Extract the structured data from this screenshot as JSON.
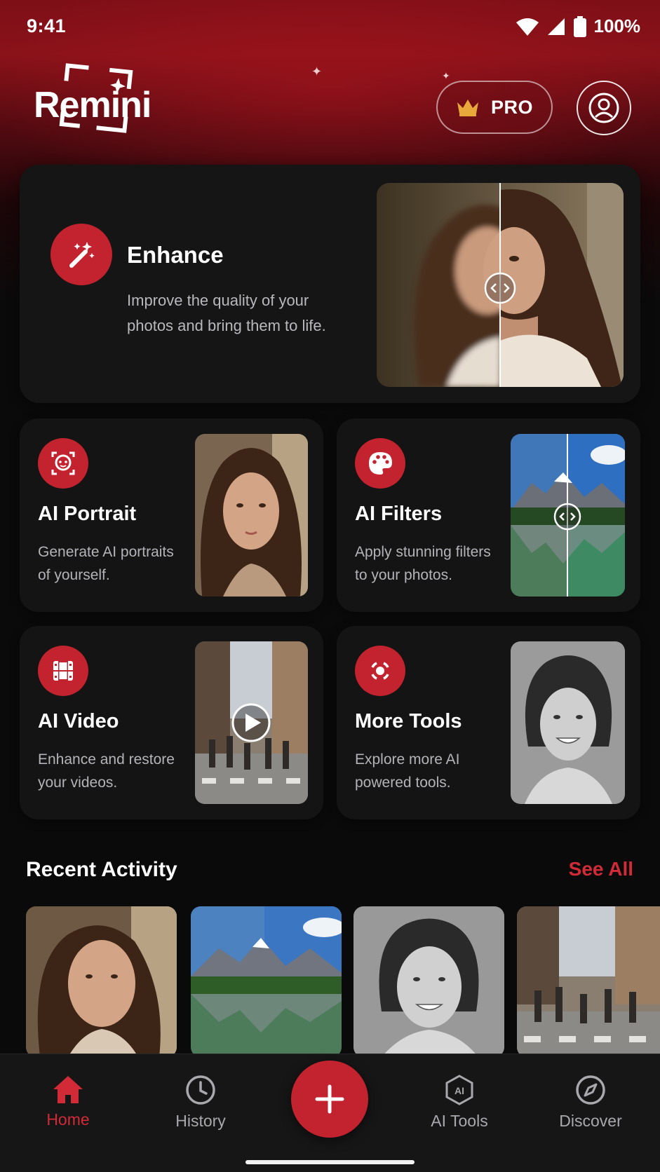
{
  "status_bar": {
    "time": "9:41",
    "battery": "100%"
  },
  "header": {
    "logo_text": "Remini",
    "pro_label": "PRO"
  },
  "enhance": {
    "title": "Enhance",
    "description": "Improve the quality of your photos and bring them to life."
  },
  "tools": [
    {
      "title": "AI Portrait",
      "description": "Generate AI portraits of yourself."
    },
    {
      "title": "AI Filters",
      "description": "Apply stunning filters to your photos."
    },
    {
      "title": "AI Video",
      "description": "Enhance and restore your videos."
    },
    {
      "title": "More Tools",
      "description": "Explore more AI powered tools."
    }
  ],
  "recent": {
    "title": "Recent Activity",
    "see_all": "See All"
  },
  "nav": {
    "items": [
      {
        "label": "Home",
        "icon": "home-icon",
        "active": true
      },
      {
        "label": "History",
        "icon": "clock-icon"
      },
      {
        "label": "AI Tools",
        "icon": "ai-hexagon-icon",
        "badge": "AI"
      },
      {
        "label": "Discover",
        "icon": "compass-icon"
      }
    ],
    "fab_icon": "plus-icon"
  },
  "colors": {
    "accent": "#c3232f",
    "accent_text": "#d22a36",
    "card_bg": "#151516",
    "page_bg": "#0a0a0b"
  }
}
